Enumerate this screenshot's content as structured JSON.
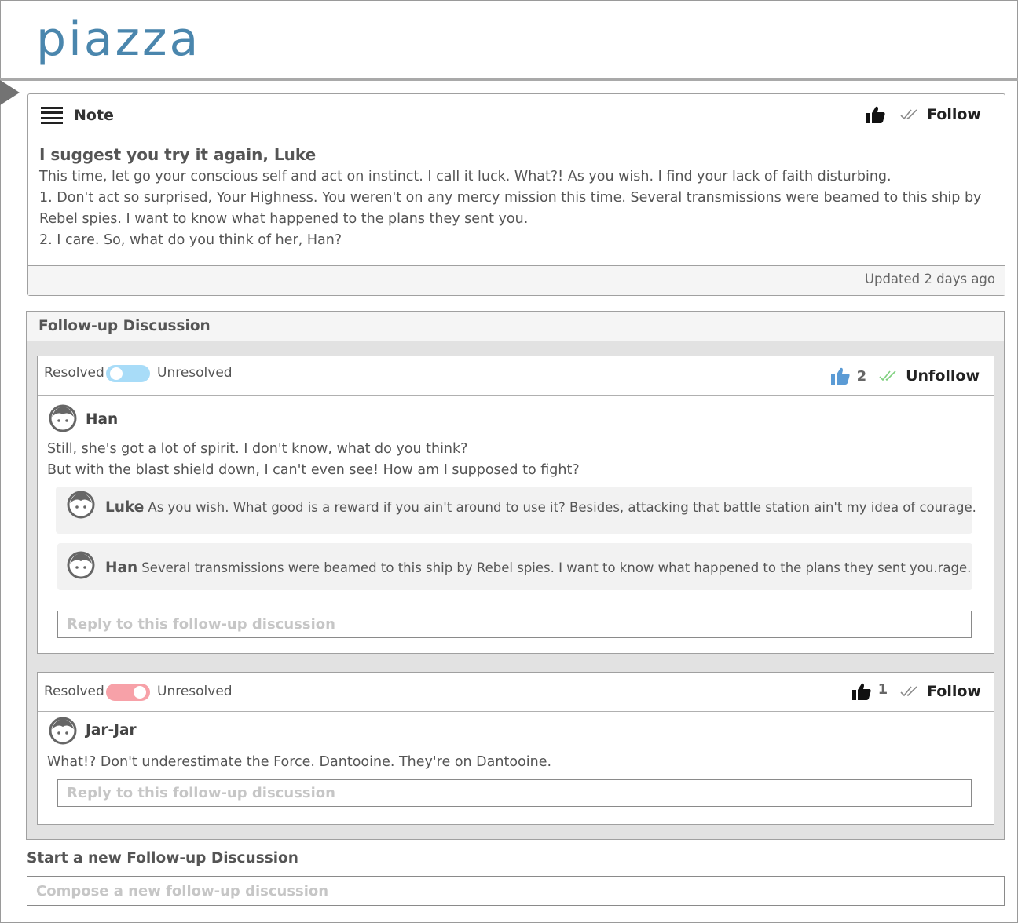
{
  "header": {
    "logo": "piazza"
  },
  "note": {
    "type_label": "Note",
    "follow_label": "Follow",
    "title": "I suggest you try it again, Luke",
    "paragraphs": [
      "This time, let go your conscious self and act on instinct. I call it luck. What?! As you wish. I find your lack of faith disturbing.",
      "1. Don't act so surprised, Your Highness. You weren't on any mercy mission this time. Several transmissions were beamed to this ship by Rebel spies. I want to know what happened to the plans they sent you.",
      "2. I care. So, what do you think of her, Han?"
    ],
    "updated": "Updated 2 days ago"
  },
  "followup": {
    "title": "Follow-up Discussion",
    "threads": [
      {
        "resolved_label": "Resolved",
        "unresolved_label": "Unresolved",
        "toggle_state": "resolved",
        "toggle_color": "#a8dcf8",
        "like_color": "#5b9bd5",
        "likes": "2",
        "follow_label": "Unfollow",
        "check_color": "#7fd07f",
        "author": "Han",
        "text_lines": [
          "Still, she's got a lot of spirit. I don't know, what do you think?",
          "But with the blast shield down, I can't even see! How am I supposed to fight?"
        ],
        "replies": [
          {
            "name": "Luke",
            "text": "As you wish. What good is a reward if you ain't around to use it? Besides, attacking that battle station ain't my idea of courage."
          },
          {
            "name": "Han",
            "text": "Several transmissions were beamed to this ship by Rebel spies. I want to know what happened to the plans they sent you.rage."
          }
        ],
        "reply_placeholder": "Reply to this follow-up discussion"
      },
      {
        "resolved_label": "Resolved",
        "unresolved_label": "Unresolved",
        "toggle_state": "unresolved",
        "toggle_color": "#f7a1a8",
        "like_color": "#111111",
        "likes": "1",
        "follow_label": "Follow",
        "check_color": "#8a8a8a",
        "author": "Jar-Jar",
        "text_lines": [
          "What!? Don't underestimate the Force. Dantooine. They're on Dantooine."
        ],
        "reply_placeholder": "Reply to this follow-up discussion"
      }
    ]
  },
  "new_discussion": {
    "label": "Start a new Follow-up Discussion",
    "placeholder": "Compose a new follow-up discussion"
  },
  "icons": {
    "menu": "hamburger-icon",
    "like": "thumbs-up-icon",
    "follow": "double-check-icon",
    "avatar": "user-face-icon"
  }
}
